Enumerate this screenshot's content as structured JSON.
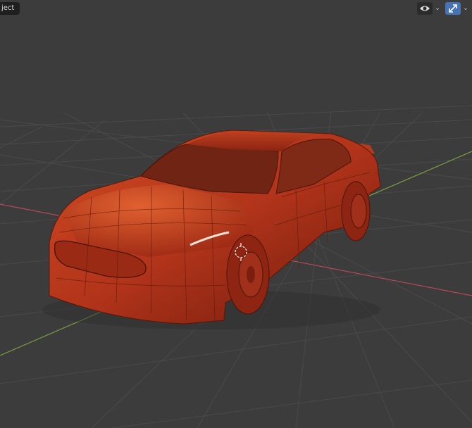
{
  "header": {
    "object_label": "ject",
    "visibility_icon": "eye-icon",
    "gizmo_icon": "gizmo-icon",
    "chevron_glyph": "⌄"
  },
  "viewport": {
    "background": "#3c3c3c",
    "grid_color": "#4a4a4a",
    "x_axis_color": "#b34a55",
    "y_axis_color": "#7aa340",
    "model_color": "#c6381a"
  }
}
